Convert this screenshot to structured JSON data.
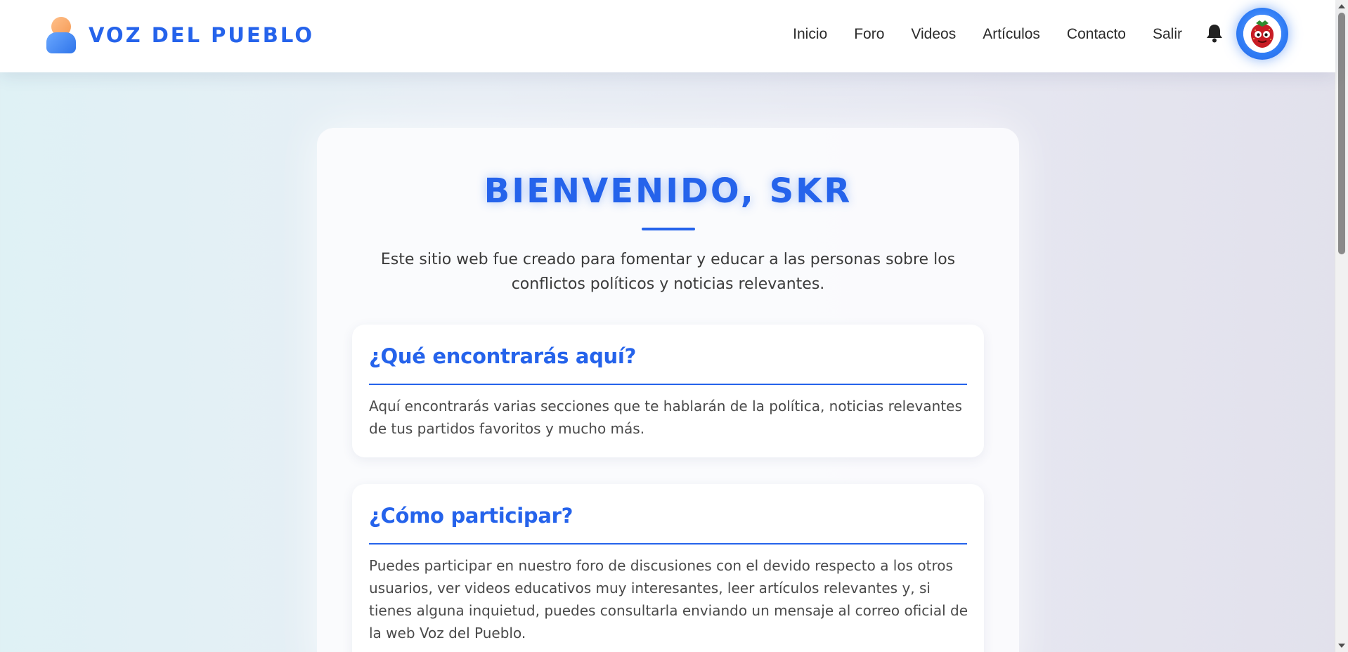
{
  "header": {
    "brand_name": "VOZ DEL PUEBLO",
    "brand_icon": "user-icon",
    "nav": [
      "Inicio",
      "Foro",
      "Videos",
      "Artículos",
      "Contacto",
      "Salir"
    ],
    "notification_icon": "bell-icon",
    "avatar_icon": "strawberry-avatar-icon"
  },
  "main": {
    "welcome_title": "BIENVENIDO, SKR",
    "intro": "Este sitio web fue creado para fomentar y educar a las personas sobre los conflictos políticos y noticias relevantes.",
    "sections": [
      {
        "heading": "¿Qué encontrarás aquí?",
        "text": "Aquí encontrarás varias secciones que te hablarán de la política, noticias relevantes de tus partidos favoritos y mucho más."
      },
      {
        "heading": "¿Cómo participar?",
        "text": "Puedes participar en nuestro foro de discusiones con el devido respecto a los otros usuarios, ver videos educativos muy interesantes, leer artículos relevantes y, si tienes alguna inquietud, puedes consultarla enviando un mensaje al correo oficial de la web Voz del Pueblo."
      }
    ]
  },
  "colors": {
    "accent": "#2563eb",
    "text": "#3b3b3b",
    "nav_text": "#2b2b2b"
  }
}
